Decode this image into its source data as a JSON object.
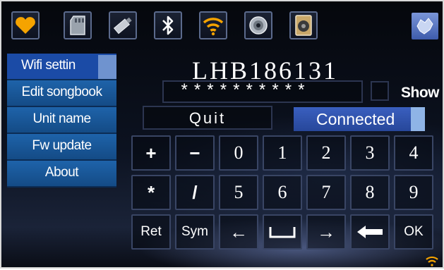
{
  "topbar": {
    "icons": [
      "heart-icon",
      "sd-card-icon",
      "usb-stick-icon",
      "bluetooth-icon",
      "wifi-icon",
      "cd-disc-icon",
      "speaker-icon"
    ],
    "logo": "logo-icon"
  },
  "menu": {
    "items": [
      {
        "label": "Wifi settin"
      },
      {
        "label": "Edit songbook"
      },
      {
        "label": "Unit name"
      },
      {
        "label": "Fw update"
      },
      {
        "label": "About"
      }
    ]
  },
  "wifi": {
    "ssid": "LHB186131",
    "password_mask": "**********",
    "show_label": "Show",
    "quit_label": "Quit",
    "connect_label": "Connected"
  },
  "keypad": {
    "row1": [
      "+",
      "−",
      "0",
      "1",
      "2",
      "3",
      "4"
    ],
    "row2": [
      "*",
      "/",
      "5",
      "6",
      "7",
      "8",
      "9"
    ],
    "row3": [
      "Ret",
      "Sym",
      "←",
      "space-key",
      "→",
      "backspace-key",
      "OK"
    ]
  },
  "colors": {
    "accent_orange": "#f5a300",
    "menu_blue": "#1e63aa",
    "selected_blue": "#3a5fbf"
  }
}
